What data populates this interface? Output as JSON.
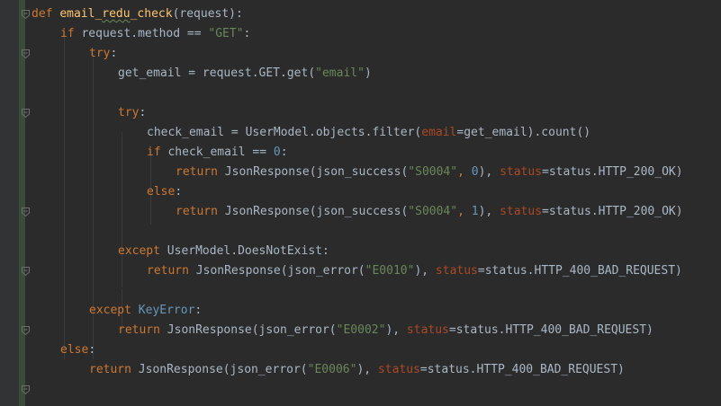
{
  "colors": {
    "background": "#2b2b2b",
    "keyword": "#cc7832",
    "function_name": "#ffc66d",
    "default_text": "#a9b7c6",
    "string": "#6a8759",
    "number": "#6897bb",
    "class_ref": "#6897bb",
    "named_param": "#aa4926"
  },
  "code": {
    "lines": [
      [
        [
          "kw",
          "def "
        ],
        [
          "fn",
          "email_"
        ],
        [
          "fn squiggle",
          "redu"
        ],
        [
          "fn",
          "_check"
        ],
        [
          "txt",
          "(request):"
        ]
      ],
      [
        [
          "kw",
          "if "
        ],
        [
          "txt",
          "request.method == "
        ],
        [
          "str",
          "\"GET\""
        ],
        [
          "txt",
          ":"
        ]
      ],
      [
        [
          "kw",
          "try"
        ],
        [
          "txt",
          ":"
        ]
      ],
      [
        [
          "txt",
          "get_email = request.GET.get("
        ],
        [
          "str",
          "\"email\""
        ],
        [
          "txt",
          ")"
        ]
      ],
      [],
      [
        [
          "kw",
          "try"
        ],
        [
          "txt",
          ":"
        ]
      ],
      [
        [
          "txt",
          "check_email = UserModel.objects.filter("
        ],
        [
          "prm",
          "email"
        ],
        [
          "txt",
          "=get_email).count()"
        ]
      ],
      [
        [
          "kw",
          "if "
        ],
        [
          "txt",
          "check_email == "
        ],
        [
          "num",
          "0"
        ],
        [
          "txt",
          ":"
        ]
      ],
      [
        [
          "kw",
          "return "
        ],
        [
          "txt",
          "JsonResponse(json_success("
        ],
        [
          "str",
          "\"S0004\""
        ],
        [
          "kw",
          ", "
        ],
        [
          "num",
          "0"
        ],
        [
          "txt",
          "), "
        ],
        [
          "prm",
          "status"
        ],
        [
          "txt",
          "=status.HTTP_200_OK)"
        ]
      ],
      [
        [
          "kw",
          "else"
        ],
        [
          "txt",
          ":"
        ]
      ],
      [
        [
          "kw",
          "return "
        ],
        [
          "txt",
          "JsonResponse(json_success("
        ],
        [
          "str",
          "\"S0004\""
        ],
        [
          "kw",
          ", "
        ],
        [
          "num",
          "1"
        ],
        [
          "txt",
          "), "
        ],
        [
          "prm",
          "status"
        ],
        [
          "txt",
          "=status.HTTP_200_OK)"
        ]
      ],
      [],
      [
        [
          "kw",
          "except "
        ],
        [
          "txt",
          "UserModel.DoesNotExist:"
        ]
      ],
      [
        [
          "kw",
          "return "
        ],
        [
          "txt",
          "JsonResponse(json_error("
        ],
        [
          "str",
          "\"E0010\""
        ],
        [
          "txt",
          "), "
        ],
        [
          "prm",
          "status"
        ],
        [
          "txt",
          "=status.HTTP_400_BAD_REQUEST)"
        ]
      ],
      [],
      [
        [
          "kw",
          "except "
        ],
        [
          "cls",
          "KeyError"
        ],
        [
          "txt",
          ":"
        ]
      ],
      [
        [
          "kw",
          "return "
        ],
        [
          "txt",
          "JsonResponse(json_error("
        ],
        [
          "str",
          "\"E0002\""
        ],
        [
          "txt",
          "), "
        ],
        [
          "prm",
          "status"
        ],
        [
          "txt",
          "=status.HTTP_400_BAD_REQUEST)"
        ]
      ],
      [
        [
          "kw",
          "else"
        ],
        [
          "txt",
          ":"
        ]
      ],
      [
        [
          "kw",
          "return "
        ],
        [
          "txt",
          "JsonResponse(json_error("
        ],
        [
          "str",
          "\"E0006\""
        ],
        [
          "txt",
          "), "
        ],
        [
          "prm",
          "status"
        ],
        [
          "txt",
          "=status.HTTP_400_BAD_REQUEST)"
        ]
      ],
      []
    ]
  }
}
